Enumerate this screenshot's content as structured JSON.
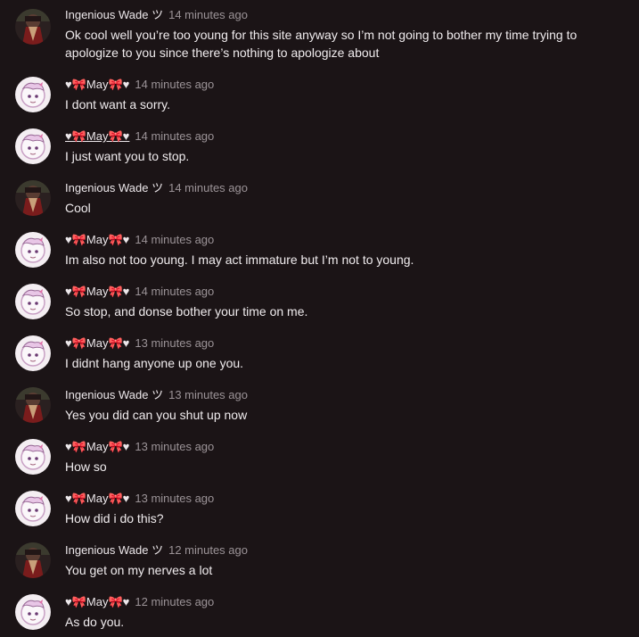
{
  "comments": [
    {
      "author": "Ingenious Wade ツ",
      "avatar": "dark-character-avatar",
      "time": "14 minutes ago",
      "text": "Ok cool well you’re too young for this site anyway so I’m not going to bother my time trying to apologize to you since there’s nothing to apologize about"
    },
    {
      "author": "♥🎀May🎀♥",
      "avatar": "pink-anime-avatar",
      "time": "14 minutes ago",
      "text": "I dont want a sorry."
    },
    {
      "author": "♥🎀May🎀♥",
      "avatar": "pink-anime-avatar",
      "time": "14 minutes ago",
      "text": "I just want you to stop."
    },
    {
      "author": "Ingenious Wade ツ",
      "avatar": "dark-character-avatar",
      "time": "14 minutes ago",
      "text": "Cool"
    },
    {
      "author": "♥🎀May🎀♥",
      "avatar": "pink-anime-avatar",
      "time": "14 minutes ago",
      "text": "Im also not too young. I may act immature but I’m not to young."
    },
    {
      "author": "♥🎀May🎀♥",
      "avatar": "pink-anime-avatar",
      "time": "14 minutes ago",
      "text": "So stop, and donse bother your time on me."
    },
    {
      "author": "♥🎀May🎀♥",
      "avatar": "pink-anime-avatar",
      "time": "13 minutes ago",
      "text": "I didnt hang anyone up one you."
    },
    {
      "author": "Ingenious Wade ツ",
      "avatar": "dark-character-avatar",
      "time": "13 minutes ago",
      "text": "Yes you did can you shut up now"
    },
    {
      "author": "♥🎀May🎀♥",
      "avatar": "pink-anime-avatar",
      "time": "13 minutes ago",
      "text": "How so"
    },
    {
      "author": "♥🎀May🎀♥",
      "avatar": "pink-anime-avatar",
      "time": "13 minutes ago",
      "text": "How did i do this?"
    },
    {
      "author": "Ingenious Wade ツ",
      "avatar": "dark-character-avatar",
      "time": "12 minutes ago",
      "text": "You get on my nerves a lot"
    },
    {
      "author": "♥🎀May🎀♥",
      "avatar": "pink-anime-avatar",
      "time": "12 minutes ago",
      "text": "As do you."
    }
  ]
}
